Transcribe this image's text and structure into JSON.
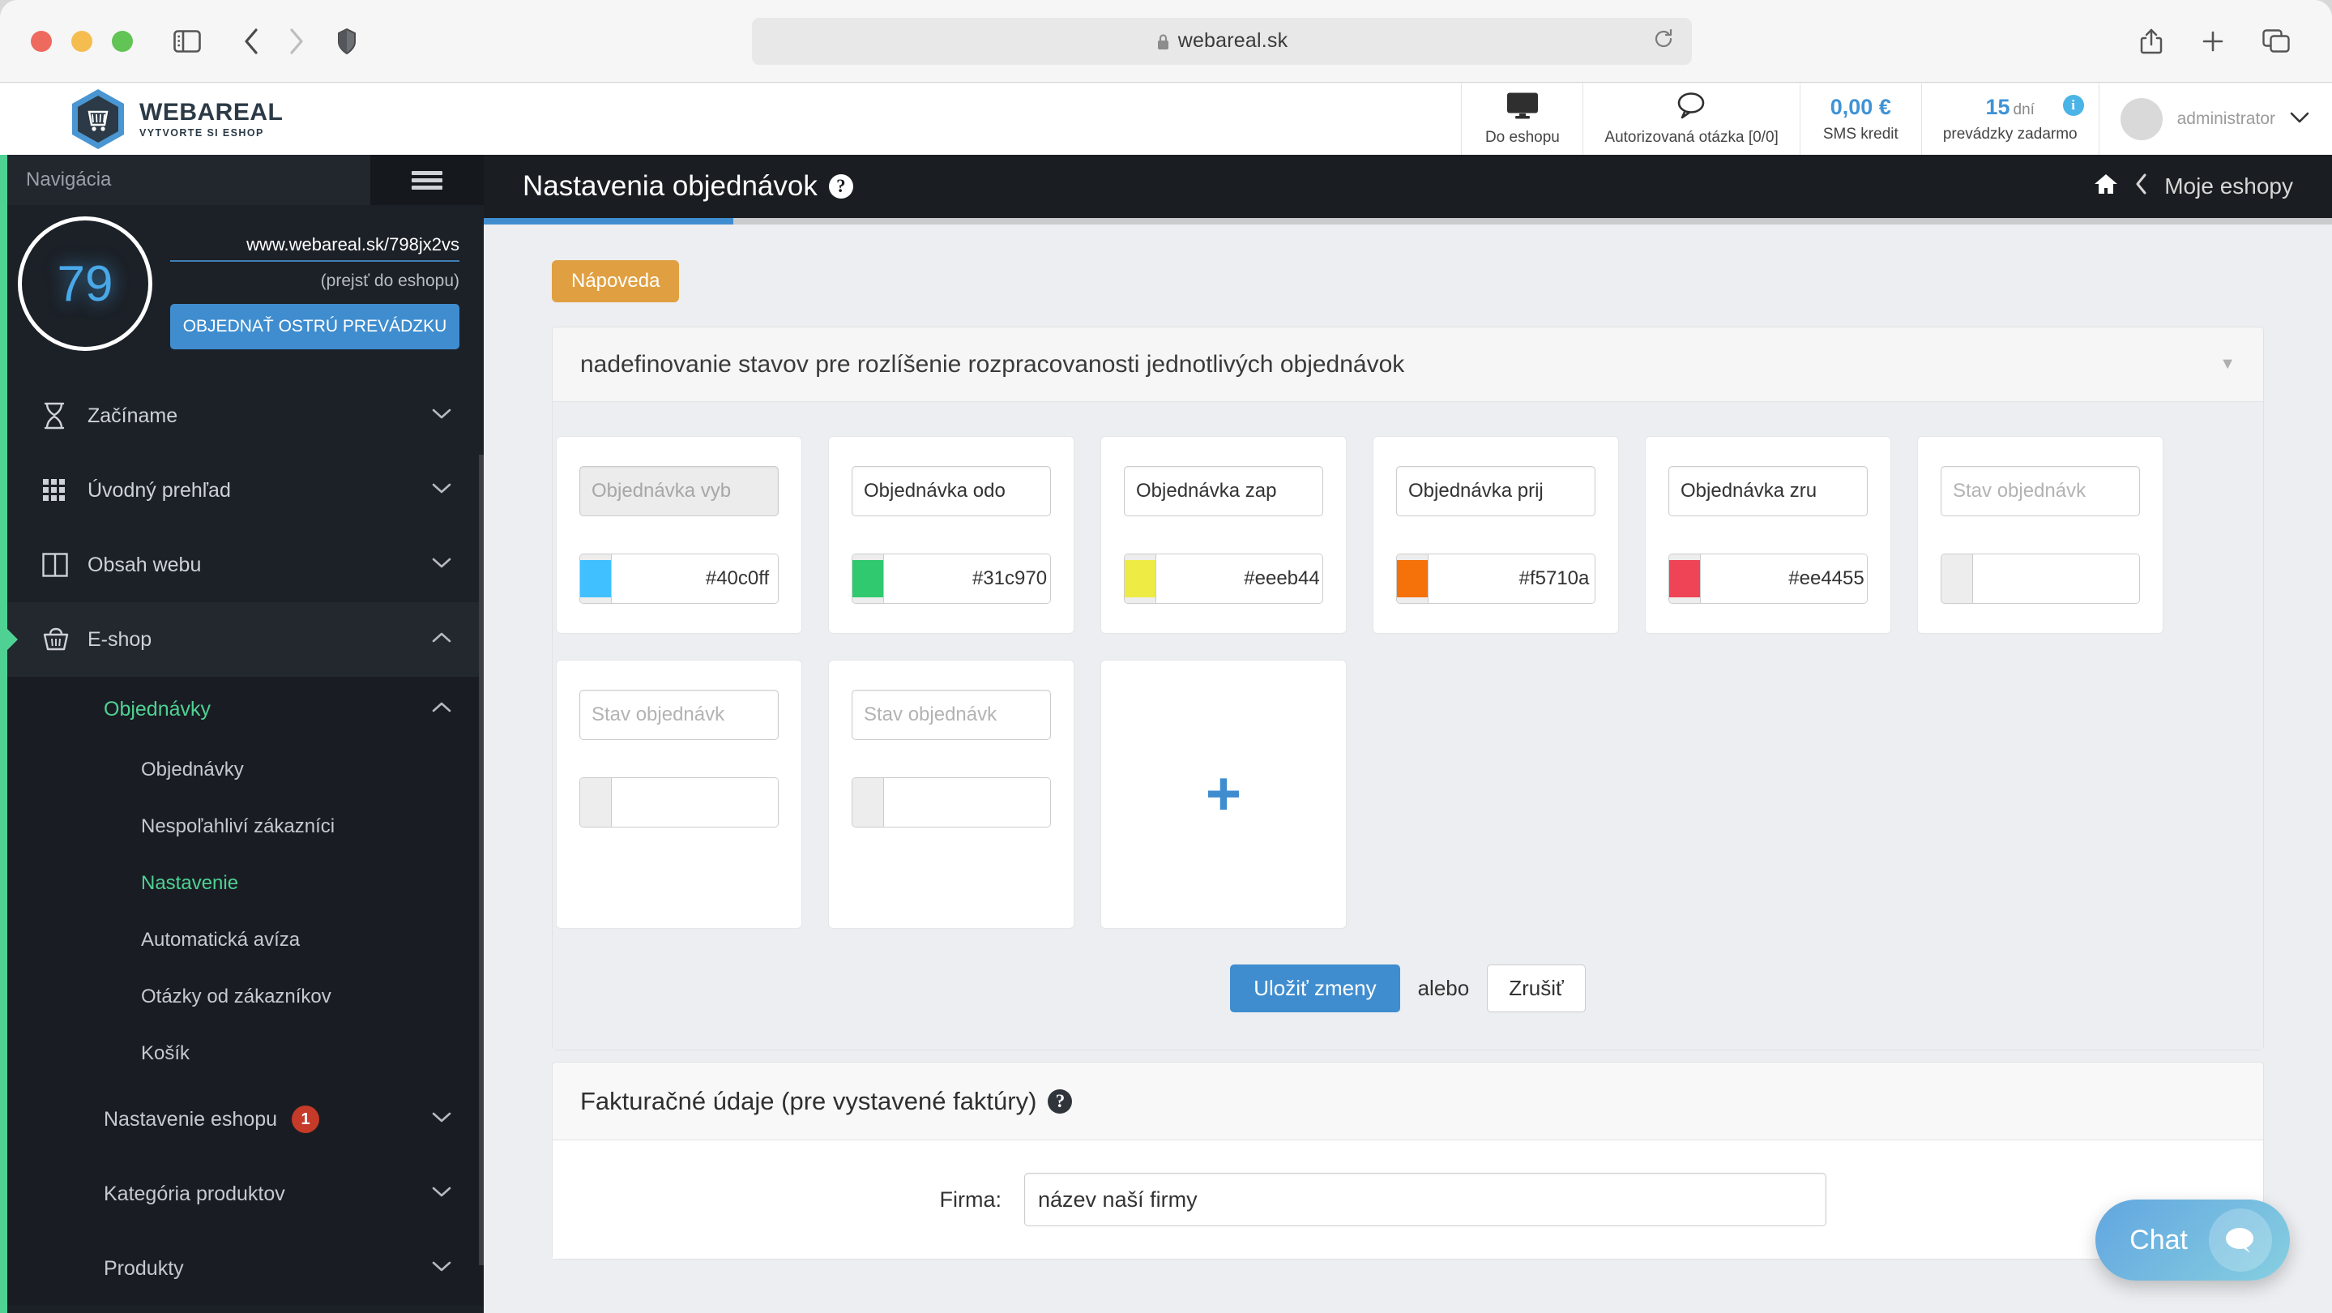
{
  "browser": {
    "url": "webareal.sk",
    "icons": {
      "sidebar": "sidebar-toggle-icon",
      "back": "back-arrow-icon",
      "forward": "forward-arrow-icon",
      "shield": "privacy-shield-icon",
      "lock": "lock-icon",
      "reload": "reload-icon",
      "share": "share-icon",
      "newtab": "plus-icon",
      "tabs": "tab-overview-icon"
    }
  },
  "app_header": {
    "logo_title": "WEBAREAL",
    "logo_subtitle": "VYTVORTE SI ESHOP",
    "cells": [
      {
        "label": "Do eshopu",
        "icon": "monitor-icon"
      },
      {
        "label": "Autorizovaná otázka [0/0]",
        "icon": "speech-bubble-icon"
      },
      {
        "big": "0,00 €",
        "label": "SMS kredit"
      },
      {
        "big": "15",
        "unit": "dní",
        "label": "prevádzky zadarmo",
        "badge": "i"
      }
    ],
    "user": "administrator"
  },
  "sidebar": {
    "nav_label": "Navigácia",
    "score": "79",
    "shop_url": "www.webareal.sk/798jx2vs",
    "goto_shop": "(prejsť do eshopu)",
    "order_button": "OBJEDNAŤ OSTRÚ PREVÁDZKU",
    "items": [
      {
        "label": "Začíname",
        "icon": "hourglass-icon",
        "color": "#8a8a8a",
        "caret": "down"
      },
      {
        "label": "Úvodný prehľad",
        "icon": "grid-icon",
        "color": "#8d5a78",
        "caret": "down"
      },
      {
        "label": "Obsah webu",
        "icon": "columns-icon",
        "color": "#3f6fa3",
        "caret": "down"
      },
      {
        "label": "E-shop",
        "icon": "basket-icon",
        "color": "#4fd193",
        "caret": "up",
        "active": true
      }
    ],
    "submenu_group": "Objednávky",
    "submenu": [
      {
        "label": "Objednávky"
      },
      {
        "label": "Nespoľahliví zákazníci"
      },
      {
        "label": "Nastavenie",
        "active": true
      },
      {
        "label": "Automatická avíza"
      },
      {
        "label": "Otázky od zákazníkov"
      },
      {
        "label": "Košík"
      }
    ],
    "level2": [
      {
        "label": "Nastavenie eshopu",
        "badge": "1"
      },
      {
        "label": "Kategória produktov"
      },
      {
        "label": "Produkty"
      }
    ]
  },
  "page": {
    "title": "Nastavenia objednávok",
    "help_glyph": "?",
    "breadcrumb": "Moje eshopy",
    "home_icon": "home-icon",
    "back_chevron": "chevron-left-icon",
    "help_button": "Nápoveda",
    "panel_title": "nadefinovanie stavov pre rozlíšenie rozpracovanosti jednotlivých objednávok",
    "status_cards": [
      {
        "name": "Objednávka vyb",
        "placeholder": "Stav objednávk",
        "hex": "#40c0ff",
        "disabled": true
      },
      {
        "name": "Objednávka odo",
        "placeholder": "Stav objednávk",
        "hex": "#31c970",
        "disabled": false
      },
      {
        "name": "Objednávka zap",
        "placeholder": "Stav objednávk",
        "hex": "#eeeb44",
        "disabled": false
      },
      {
        "name": "Objednávka prij",
        "placeholder": "Stav objednávk",
        "hex": "#f5710a",
        "disabled": false
      },
      {
        "name": "Objednávka zru",
        "placeholder": "Stav objednávk",
        "hex": "#ee4455",
        "disabled": false
      },
      {
        "name": "",
        "placeholder": "Stav objednávk",
        "hex": "",
        "disabled": false
      },
      {
        "name": "",
        "placeholder": "Stav objednávk",
        "hex": "",
        "disabled": false
      },
      {
        "name": "",
        "placeholder": "Stav objednávk",
        "hex": "",
        "disabled": false
      }
    ],
    "add_card_glyph": "+",
    "save_button": "Uložiť zmeny",
    "or_text": "alebo",
    "cancel_button": "Zrušiť",
    "billing_panel_title": "Fakturačné údaje (pre vystavené faktúry)",
    "firma_label": "Firma:",
    "firma_value": "název naší firmy"
  },
  "chat": {
    "label": "Chat",
    "icon": "chat-bubble-icon"
  },
  "colors": {
    "accent_blue": "#3f8dcf",
    "sidebar_bg": "#1c2027",
    "green": "#4fd193",
    "orange": "#e0a042",
    "red_badge": "#c53a28"
  }
}
